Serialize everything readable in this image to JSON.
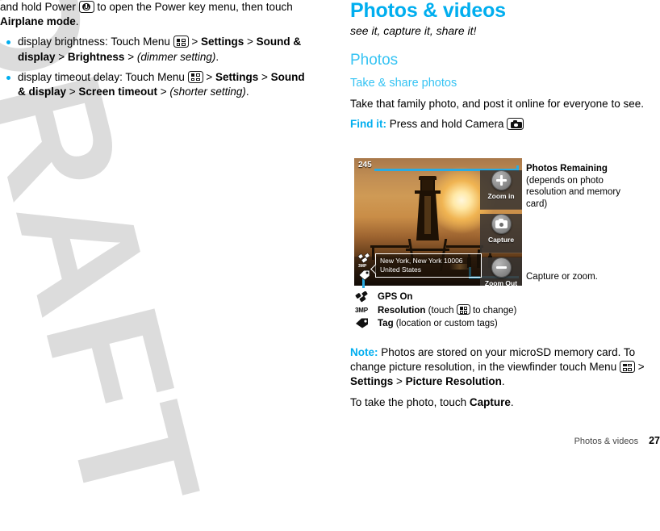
{
  "watermark": {
    "text": "DRAFT"
  },
  "left_column": {
    "continued_paragraph": {
      "part1": "and hold Power ",
      "icon": "power-key-icon",
      "part2": " to open the Power key menu, then touch ",
      "bold": "Airplane mode",
      "part3": "."
    },
    "bullets": [
      {
        "lead": "display brightness: Touch Menu ",
        "icon": "menu-key-icon",
        "sep1": " > ",
        "b1": "Settings",
        "sep2": " > ",
        "b2": "Sound & display",
        "sep3": " > ",
        "b3": "Brightness",
        "sep4": " > ",
        "italic": "(dimmer setting)",
        "tail": "."
      },
      {
        "lead": "display timeout delay: Touch Menu ",
        "icon": "menu-key-icon",
        "sep1": " > ",
        "b1": "Settings",
        "sep2": " > ",
        "b2": "Sound & display",
        "sep3": " > ",
        "b3": "Screen timeout",
        "sep4": " > ",
        "italic": "(shorter setting)",
        "tail": "."
      }
    ]
  },
  "right_column": {
    "title": "Photos & videos",
    "tagline": "see it, capture it, share it!",
    "section_heading": "Photos",
    "sub_heading": "Take & share photos",
    "intro_paragraph": "Take that family photo, and post it online for everyone to see.",
    "find_it": {
      "label": "Find it:",
      "text": " Press and hold Camera ",
      "icon": "camera-key-icon"
    },
    "note": {
      "label": "Note:",
      "text_part1": " Photos are stored on your microSD memory card. To change picture resolution, in the viewfinder touch Menu ",
      "icon": "menu-key-icon",
      "sep1": " > ",
      "b1": "Settings",
      "sep2": " > ",
      "b2": "Picture Resolution",
      "tail": "."
    },
    "closing": {
      "part1": "To take the photo, touch ",
      "bold": "Capture",
      "part2": "."
    }
  },
  "figure": {
    "viewfinder": {
      "photo_counter": "245",
      "tooltip_line1": "New York, New York 10006",
      "tooltip_line2": "United States",
      "controls": [
        {
          "name": "zoom-in",
          "label": "Zoom in",
          "icon": "plus-circle-icon"
        },
        {
          "name": "capture",
          "label": "Capture",
          "icon": "camera-icon"
        },
        {
          "name": "zoom-out",
          "label": "Zoom Out",
          "icon": "minus-circle-icon"
        }
      ],
      "status_icons": [
        {
          "name": "gps-icon"
        },
        {
          "name": "tag-icon"
        }
      ]
    },
    "callouts": [
      {
        "name": "photos-remaining",
        "title": "Photos Remaining",
        "body": "(depends on photo resolution and memory card)"
      },
      {
        "name": "capture-or-zoom",
        "title": "",
        "body": "Capture or zoom."
      }
    ],
    "legend": [
      {
        "icon": "gps-satellite-icon",
        "bold": "GPS On",
        "rest": ""
      },
      {
        "icon": "resolution-3mp-icon",
        "bold": "Resolution",
        "rest_pre": " (touch ",
        "inline_icon": "menu-key-icon",
        "rest_post": " to change)"
      },
      {
        "icon": "tag-icon",
        "bold": "Tag",
        "rest": " (location or custom tags)"
      }
    ]
  },
  "footer": {
    "section": "Photos & videos",
    "page_number": "27"
  },
  "colors": {
    "accent": "#00AEEF",
    "accent_light": "#35C3F3",
    "callout_line": "#29ABE2",
    "watermark": "#dcdcdc"
  }
}
